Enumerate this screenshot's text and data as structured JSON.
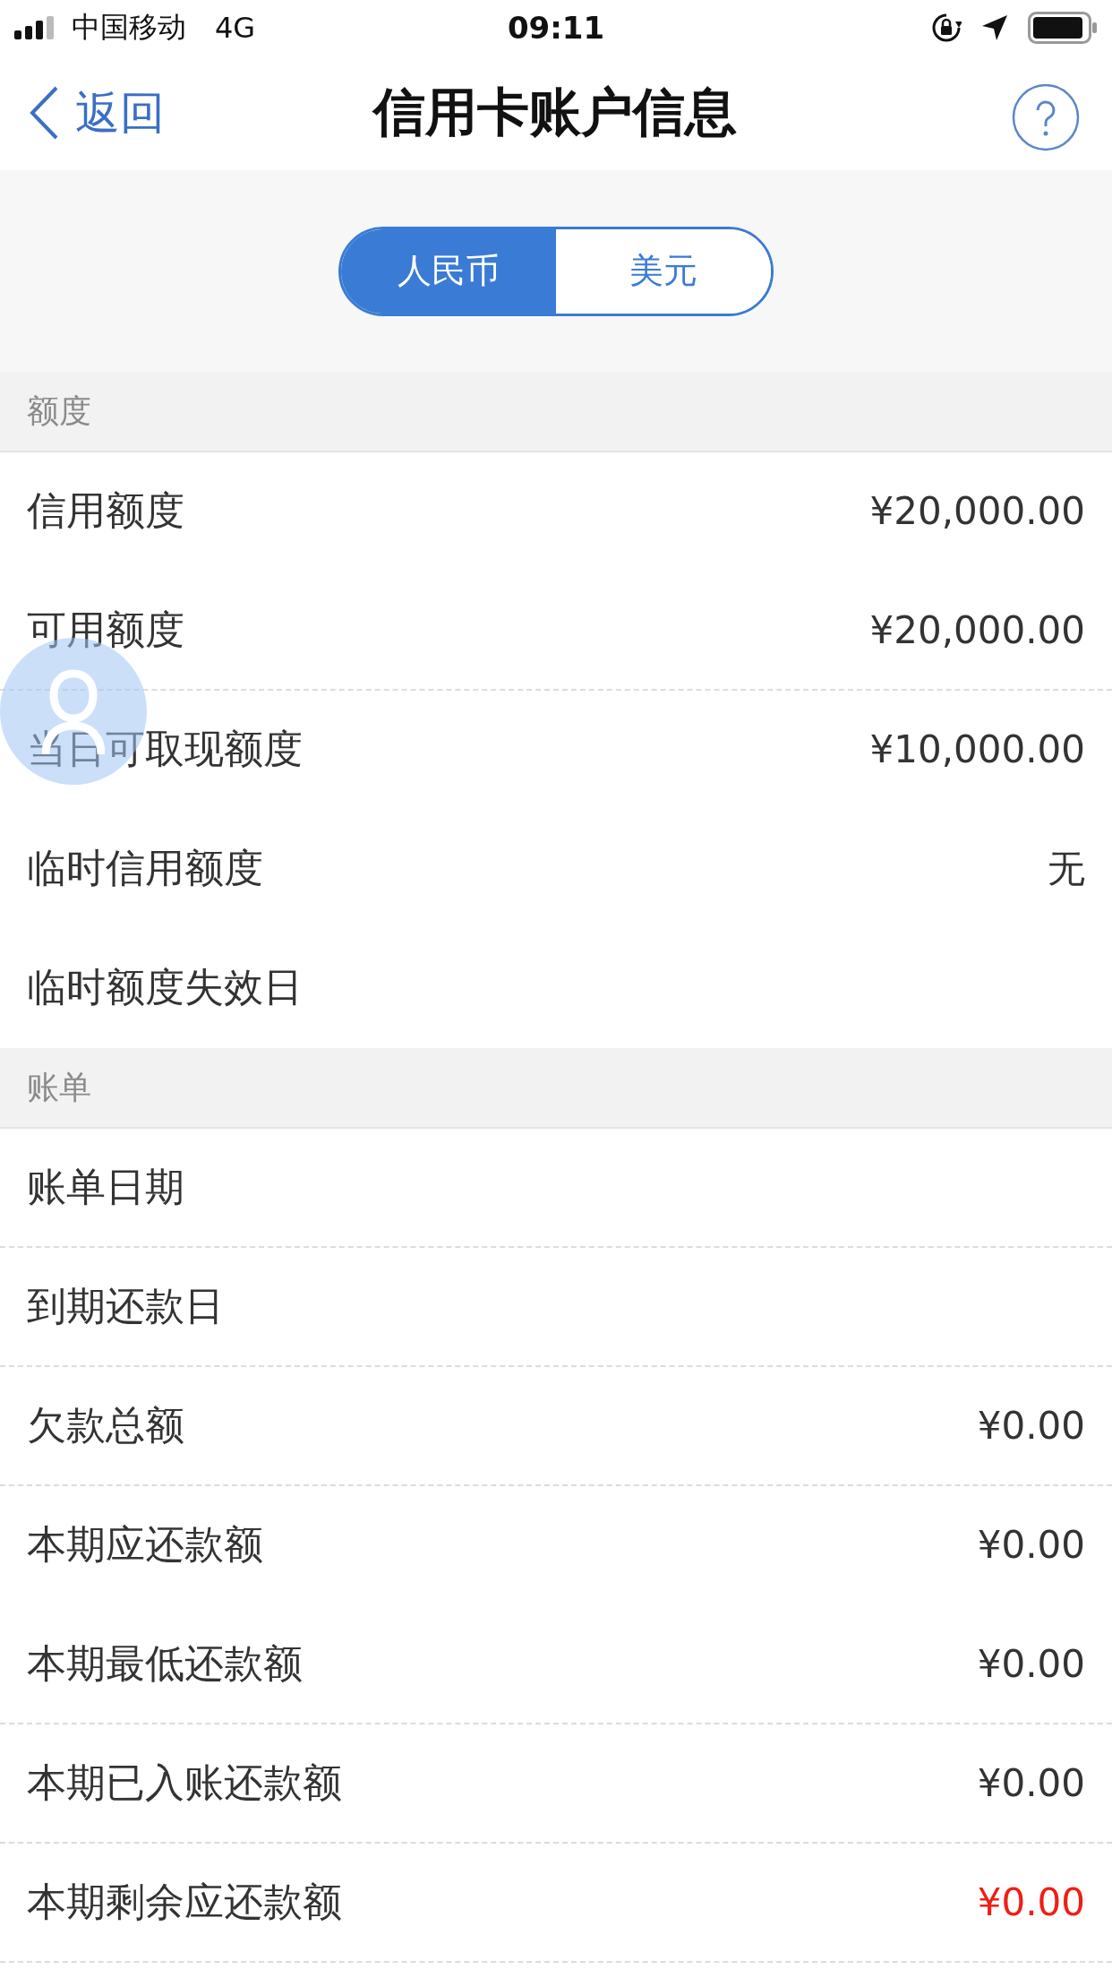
{
  "status_bar": {
    "carrier": "中国移动",
    "network": "4G",
    "time": "09:11"
  },
  "nav": {
    "back": "返回",
    "title": "信用卡账户信息"
  },
  "currency_tabs": [
    {
      "label": "人民币",
      "selected": true
    },
    {
      "label": "美元",
      "selected": false
    }
  ],
  "sections": [
    {
      "title": "额度",
      "rows": [
        {
          "label": "信用额度",
          "value": "¥20,000.00",
          "divider": false,
          "alert": false
        },
        {
          "label": "可用额度",
          "value": "¥20,000.00",
          "divider": true,
          "alert": false
        },
        {
          "label": "当日可取现额度",
          "value": "¥10,000.00",
          "divider": false,
          "alert": false
        },
        {
          "label": "临时信用额度",
          "value": "无",
          "divider": false,
          "alert": false
        },
        {
          "label": "临时额度失效日",
          "divider": false
        }
      ]
    },
    {
      "title": "账单",
      "rows": [
        {
          "label": "账单日期",
          "divider": true
        },
        {
          "label": "到期还款日",
          "divider": true
        },
        {
          "label": "欠款总额",
          "value": "¥0.00",
          "divider": true,
          "alert": false
        },
        {
          "label": "本期应还款额",
          "value": "¥0.00",
          "divider": false,
          "alert": false
        },
        {
          "label": "本期最低还款额",
          "value": "¥0.00",
          "divider": true,
          "alert": false
        },
        {
          "label": "本期已入账还款额",
          "value": "¥0.00",
          "divider": true,
          "alert": false
        },
        {
          "label": "本期剩余应还款额",
          "value": "¥0.00",
          "divider": true,
          "alert": true
        }
      ]
    }
  ]
}
